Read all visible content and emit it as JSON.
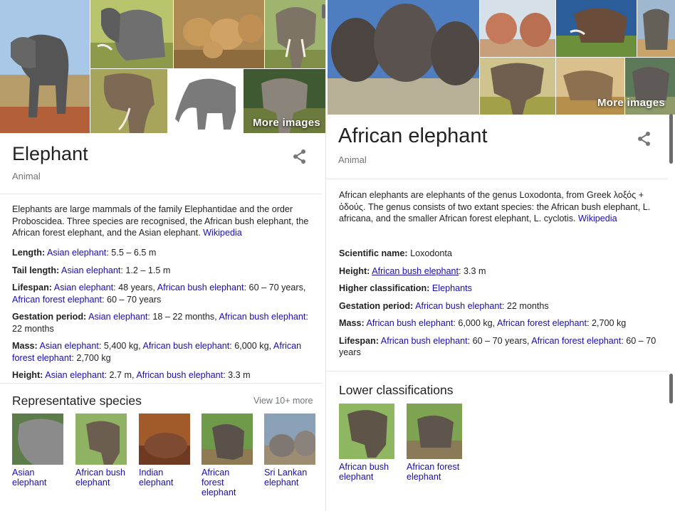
{
  "left": {
    "more_images": "More images",
    "title": "Elephant",
    "subtitle": "Animal",
    "description": "Elephants are large mammals of the family Elephantidae and the order Proboscidea. Three species are recognised, the African bush elephant, the African forest elephant, and the Asian elephant.",
    "description_link": "Wikipedia",
    "facts": [
      {
        "label": "Length:",
        "parts": [
          {
            "link": "Asian elephant"
          },
          {
            "text": ": 5.5 – 6.5 m"
          }
        ]
      },
      {
        "label": "Tail length:",
        "parts": [
          {
            "link": "Asian elephant"
          },
          {
            "text": ": 1.2 – 1.5 m"
          }
        ]
      },
      {
        "label": "Lifespan:",
        "parts": [
          {
            "link": "Asian elephant"
          },
          {
            "text": ": 48 years, "
          },
          {
            "link": "African bush elephant"
          },
          {
            "text": ": 60 – 70 years, "
          },
          {
            "link": "African forest elephant"
          },
          {
            "text": ": 60 – 70 years"
          }
        ]
      },
      {
        "label": "Gestation period:",
        "parts": [
          {
            "link": "Asian elephant"
          },
          {
            "text": ": 18 – 22 months, "
          },
          {
            "link": "African bush elephant"
          },
          {
            "text": ": 22 months"
          }
        ]
      },
      {
        "label": "Mass:",
        "parts": [
          {
            "link": "Asian elephant"
          },
          {
            "text": ": 5,400 kg, "
          },
          {
            "link": "African bush elephant"
          },
          {
            "text": ": 6,000 kg, "
          },
          {
            "link": "African forest elephant"
          },
          {
            "text": ": 2,700 kg"
          }
        ]
      },
      {
        "label": "Height:",
        "parts": [
          {
            "link": "Asian elephant"
          },
          {
            "text": ": 2.7 m, "
          },
          {
            "link": "African bush elephant"
          },
          {
            "text": ": 3.3 m"
          }
        ]
      }
    ],
    "section_title": "Representative species",
    "view_more": "View 10+ more",
    "species": [
      {
        "name": "Asian elephant"
      },
      {
        "name": "African bush elephant"
      },
      {
        "name": "Indian elephant"
      },
      {
        "name": "African forest elephant"
      },
      {
        "name": "Sri Lankan elephant"
      }
    ]
  },
  "right": {
    "more_images": "More images",
    "title": "African elephant",
    "subtitle": "Animal",
    "description": "African elephants are elephants of the genus Loxodonta, from Greek λοξός + ὀδούς. The genus consists of two extant species: the African bush elephant, L. africana, and the smaller African forest elephant, L. cyclotis.",
    "description_link": "Wikipedia",
    "facts": [
      {
        "label": "Scientific name:",
        "parts": [
          {
            "text": " Loxodonta"
          }
        ]
      },
      {
        "label": "Height:",
        "parts": [
          {
            "link": "African bush elephant",
            "underline": true
          },
          {
            "text": ": 3.3 m"
          }
        ]
      },
      {
        "label": "Higher classification:",
        "parts": [
          {
            "link": "Elephants"
          }
        ]
      },
      {
        "label": "Gestation period:",
        "parts": [
          {
            "link": "African bush elephant"
          },
          {
            "text": ": 22 months"
          }
        ]
      },
      {
        "label": "Mass:",
        "parts": [
          {
            "link": "African bush elephant"
          },
          {
            "text": ": 6,000 kg, "
          },
          {
            "link": "African forest elephant"
          },
          {
            "text": ": 2,700 kg"
          }
        ]
      },
      {
        "label": "Lifespan:",
        "parts": [
          {
            "link": "African bush elephant"
          },
          {
            "text": ": 60 – 70 years, "
          },
          {
            "link": "African forest elephant"
          },
          {
            "text": ": 60 – 70 years"
          }
        ]
      }
    ],
    "section_title": "Lower classifications",
    "lower": [
      {
        "name": "African bush elephant"
      },
      {
        "name": "African forest elephant"
      }
    ]
  },
  "colors": {
    "link": "#1a0dab",
    "muted": "#70757a",
    "text": "#222222"
  }
}
